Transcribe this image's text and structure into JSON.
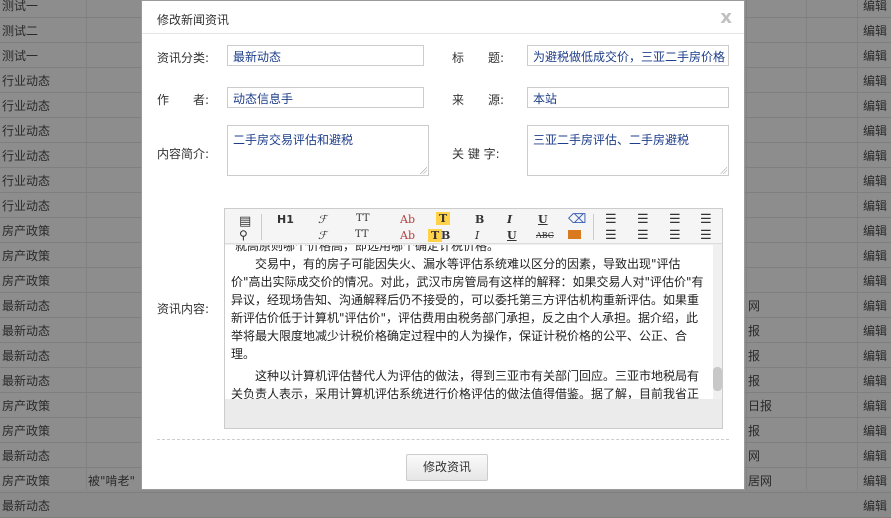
{
  "background_rows": [
    {
      "category": "测试一",
      "title": "",
      "source": "",
      "action": "编辑"
    },
    {
      "category": "测试二",
      "title": "",
      "source": "",
      "action": "编辑"
    },
    {
      "category": "测试一",
      "title": "",
      "source": "",
      "action": "编辑"
    },
    {
      "category": "行业动态",
      "title": "",
      "source": "",
      "action": "编辑"
    },
    {
      "category": "行业动态",
      "title": "",
      "source": "",
      "action": "编辑"
    },
    {
      "category": "行业动态",
      "title": "",
      "source": "",
      "action": "编辑"
    },
    {
      "category": "行业动态",
      "title": "",
      "source": "",
      "action": "编辑"
    },
    {
      "category": "行业动态",
      "title": "",
      "source": "",
      "action": "编辑"
    },
    {
      "category": "行业动态",
      "title": "",
      "source": "",
      "action": "编辑"
    },
    {
      "category": "房产政策",
      "title": "",
      "source": "",
      "action": "编辑"
    },
    {
      "category": "房产政策",
      "title": "",
      "source": "",
      "action": "编辑"
    },
    {
      "category": "房产政策",
      "title": "",
      "source": "",
      "action": "编辑"
    },
    {
      "category": "最新动态",
      "title": "",
      "source": "网",
      "action": "编辑"
    },
    {
      "category": "最新动态",
      "title": "",
      "source": "报",
      "action": "编辑"
    },
    {
      "category": "最新动态",
      "title": "",
      "source": "报",
      "action": "编辑"
    },
    {
      "category": "最新动态",
      "title": "",
      "source": "报",
      "action": "编辑"
    },
    {
      "category": "房产政策",
      "title": "",
      "source": "日报",
      "action": "编辑"
    },
    {
      "category": "房产政策",
      "title": "",
      "source": "报",
      "action": "编辑"
    },
    {
      "category": "最新动态",
      "title": "",
      "source": "网",
      "action": "编辑"
    },
    {
      "category": "房产政策",
      "title": "被\"啃老\"",
      "source": "居网",
      "action": "编辑"
    },
    {
      "category": "最新动态",
      "title": "",
      "source": "",
      "action": "编辑"
    }
  ],
  "modal": {
    "title": "修改新闻资讯",
    "close": "x",
    "labels": {
      "category": "资讯分类:",
      "title": "标　　题:",
      "author": "作　　者:",
      "source": "来　　源:",
      "summary": "内容简介:",
      "keywords": "关 键 字:",
      "content": "资讯内容:"
    },
    "values": {
      "category": "最新动态",
      "title": "为避税做低成交价，三亚二手房价格",
      "author": "动态信息手",
      "source": "本站",
      "summary": "二手房交易评估和避税",
      "keywords": "三亚二手房评估、二手房避税"
    },
    "editor": {
      "toolbar_row1": [
        "H1",
        "ℱ",
        "TT",
        "Ab",
        "T",
        "B",
        "I",
        "U"
      ],
      "toolbar_row2": [
        "ℱ",
        "TT",
        "Ab",
        "T",
        "B",
        "I",
        "U",
        "ABC"
      ],
      "paragraphs": [
        "就高原则哪个价格高，即选用哪个确定计税价格。",
        "交易中，有的房子可能因失火、漏水等评估系统难以区分的因素，导致出现\"评估价\"高出实际成交价的情况。对此，武汉市房管局有这样的解释：如果交易人对\"评估价\"有异议，经现场告知、沟通解释后仍不接受的，可以委托第三方评估机构重新评估。如果重新评估价低于计算机\"评估价\"，评估费用由税务部门承担，反之由个人承担。据介绍，此举将最大限度地减少计税价格确定过程中的人为操作，保证计税价格的公平、公正、合理。",
        "这种以计算机评估替代人为评估的做法，得到三亚市有关部门回应。三亚市地税局有关负责人表示，采用计算机评估系统进行价格评估的做法值得借鉴。据了解，目前我省正在酝酿实施存量房交易计税价格评估系统，只要输入房屋价格因素，系统会自动生成评估"
      ]
    },
    "submit_label": "修改资讯"
  }
}
